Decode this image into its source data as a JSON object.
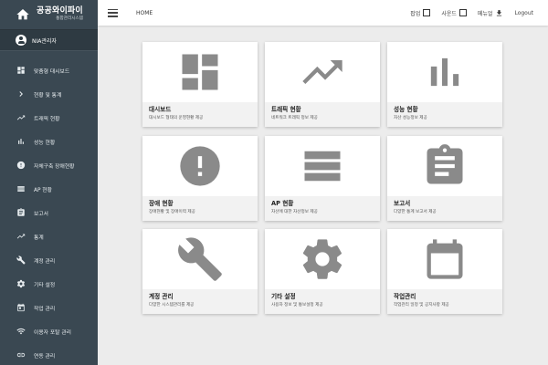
{
  "brand": {
    "title": "공공와이파이",
    "subtitle": "통합관리시스템"
  },
  "user": {
    "name": "NIA관리자"
  },
  "sidebar": {
    "items": [
      {
        "label": "맞춤형 대시보드",
        "icon": "dashboard-icon"
      },
      {
        "label": "현황 및 통계",
        "icon": "chevron-right-icon"
      },
      {
        "label": "트래픽 현황",
        "icon": "trend-icon"
      },
      {
        "label": "성능 현황",
        "icon": "bar-chart-icon"
      },
      {
        "label": "자체구축 장애현황",
        "icon": "alert-icon"
      },
      {
        "label": "AP 현황",
        "icon": "list-icon"
      },
      {
        "label": "보고서",
        "icon": "clipboard-icon"
      },
      {
        "label": "통계",
        "icon": "trend-icon"
      },
      {
        "label": "계정 관리",
        "icon": "wrench-icon"
      },
      {
        "label": "기타 설정",
        "icon": "gear-icon"
      },
      {
        "label": "작업 관리",
        "icon": "calendar-icon"
      },
      {
        "label": "이용자 포탈 관리",
        "icon": "wifi-icon"
      },
      {
        "label": "연동 관리",
        "icon": "link-icon"
      }
    ]
  },
  "topbar": {
    "breadcrumb": "HOME",
    "popup_label": "팝업",
    "sound_label": "사운드",
    "manual_label": "메뉴얼",
    "logout_label": "Logout"
  },
  "cards": [
    {
      "title": "대시보드",
      "desc": "대시보드 형태의 운영현황 제공",
      "icon": "dashboard-icon"
    },
    {
      "title": "트래픽 현황",
      "desc": "네트워크 트래픽 정보 제공",
      "icon": "trend-icon"
    },
    {
      "title": "성능 현황",
      "desc": "자산 성능정보 제공",
      "icon": "bar-chart-icon"
    },
    {
      "title": "장애 현황",
      "desc": "장애현황 및 장애이력 제공",
      "icon": "alert-icon"
    },
    {
      "title": "AP 현황",
      "desc": "자산에 대한 자산정보 제공",
      "icon": "list-icon"
    },
    {
      "title": "보고서",
      "desc": "다양한 통계 보고서 제공",
      "icon": "clipboard-icon"
    },
    {
      "title": "계정 관리",
      "desc": "다양한 시스템관리를 제공",
      "icon": "wrench-icon"
    },
    {
      "title": "기타 설정",
      "desc": "사용자 정보 및 통보설정 제공",
      "icon": "gear-icon"
    },
    {
      "title": "작업관리",
      "desc": "작업관리 일정 및 공지사항 제공",
      "icon": "calendar-icon"
    }
  ],
  "colors": {
    "sidebar": "#3a4852",
    "icon_gray": "#8a8a8a",
    "background": "#ececec"
  }
}
